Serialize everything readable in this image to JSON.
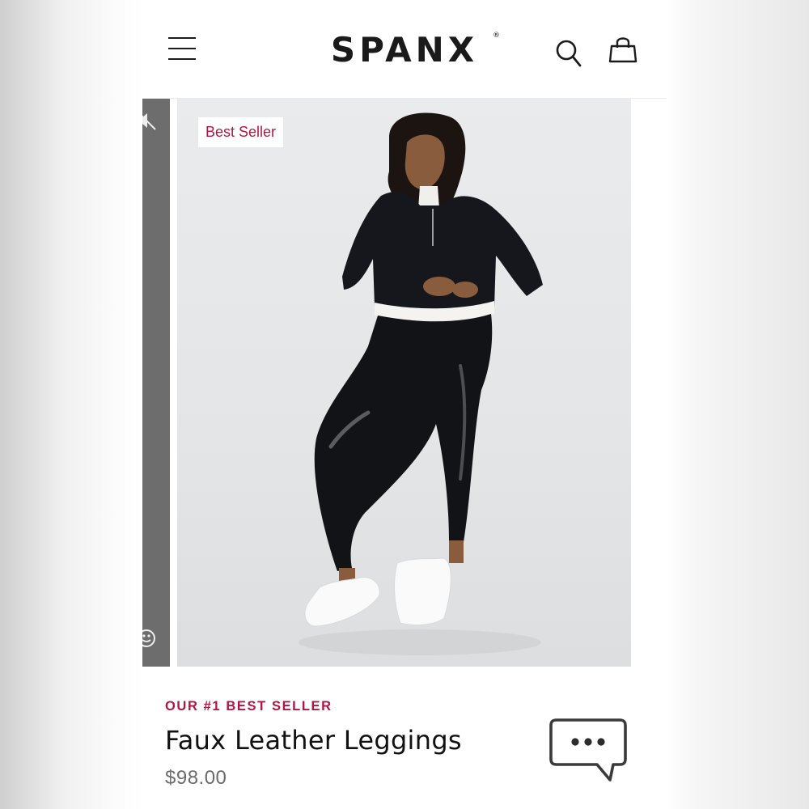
{
  "header": {
    "brand": "SPANX",
    "brand_mark": "®",
    "icons": {
      "menu": "hamburger-menu-icon",
      "search": "search-icon",
      "bag": "shopping-bag-icon"
    }
  },
  "carousel": {
    "badge": "Best Seller",
    "prev_slide_icons": [
      "mute-icon",
      "face-icon"
    ]
  },
  "product": {
    "eyebrow": "OUR #1 BEST SELLER",
    "name": "Faux Leather Leggings",
    "price": "$98.00"
  },
  "chat": {
    "icon": "chat-bubble-icon"
  },
  "colors": {
    "accent": "#b01642",
    "text": "#111111",
    "muted": "#6b6b6b",
    "prev_slide": "#6d6d6d"
  }
}
